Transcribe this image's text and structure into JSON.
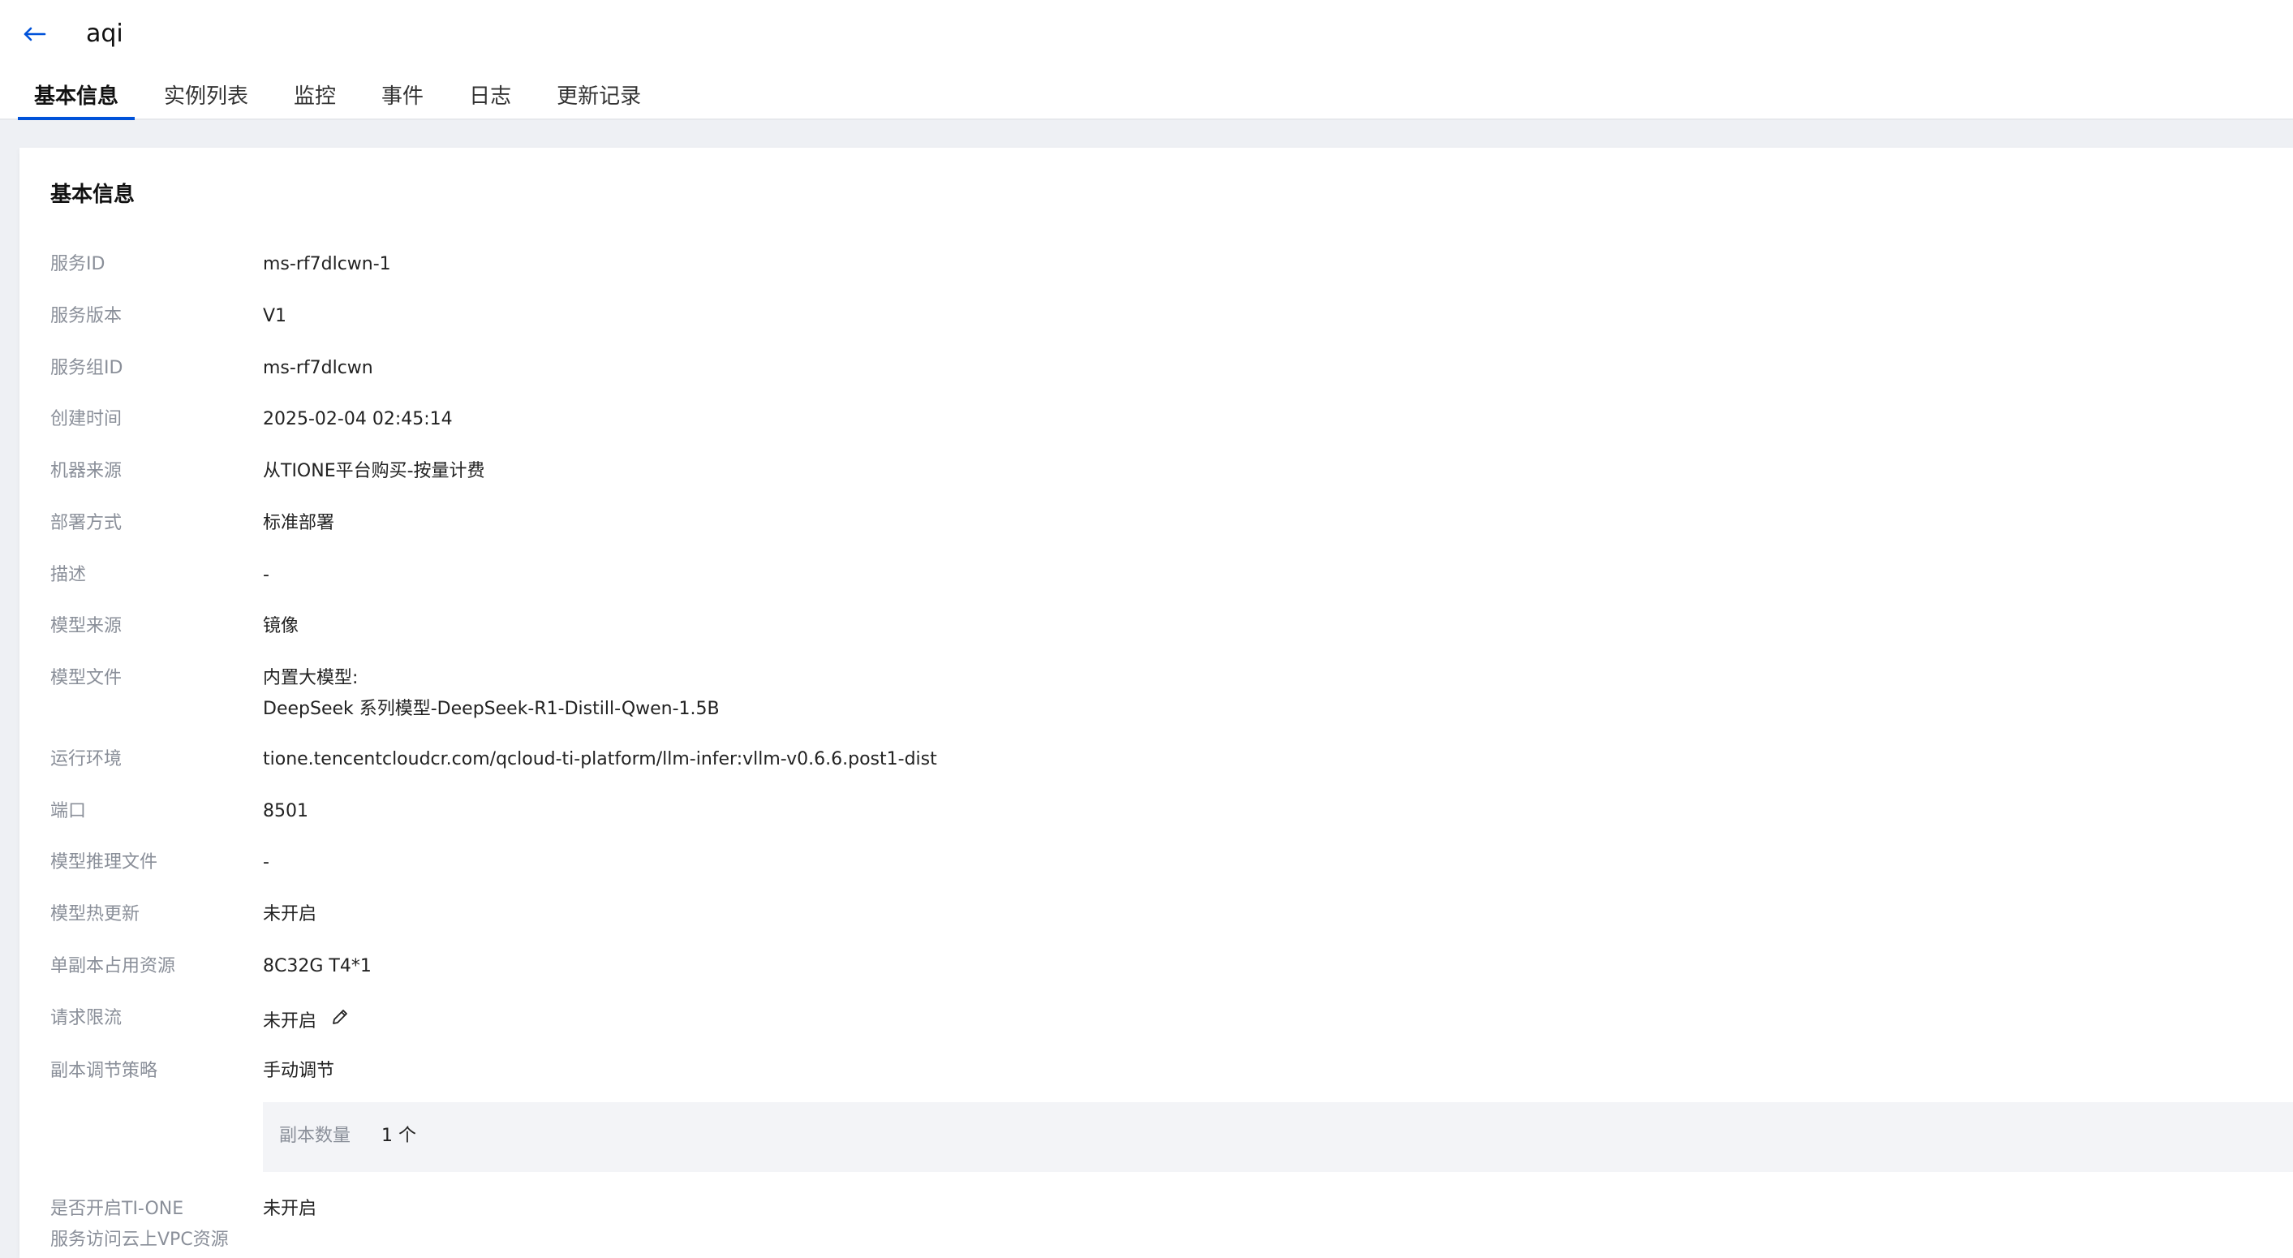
{
  "header": {
    "title": "aqi",
    "tabs": [
      {
        "label": "基本信息",
        "active": true
      },
      {
        "label": "实例列表",
        "active": false
      },
      {
        "label": "监控",
        "active": false
      },
      {
        "label": "事件",
        "active": false
      },
      {
        "label": "日志",
        "active": false
      },
      {
        "label": "更新记录",
        "active": false
      }
    ]
  },
  "basic_info": {
    "title": "基本信息",
    "rows": [
      {
        "label": "服务ID",
        "value": "ms-rf7dlcwn-1"
      },
      {
        "label": "服务版本",
        "value": "V1"
      },
      {
        "label": "服务组ID",
        "value": "ms-rf7dlcwn"
      },
      {
        "label": "创建时间",
        "value": "2025-02-04 02:45:14"
      },
      {
        "label": "机器来源",
        "value": "从TIONE平台购买-按量计费"
      },
      {
        "label": "部署方式",
        "value": "标准部署"
      },
      {
        "label": "描述",
        "value": "-"
      },
      {
        "label": "模型来源",
        "value": "镜像"
      },
      {
        "label": "模型文件",
        "value": "内置大模型:",
        "value2": "DeepSeek 系列模型-DeepSeek-R1-Distill-Qwen-1.5B"
      },
      {
        "label": "运行环境",
        "value": "tione.tencentcloudcr.com/qcloud-ti-platform/llm-infer:vllm-v0.6.6.post1-dist"
      },
      {
        "label": "端口",
        "value": "8501"
      },
      {
        "label": "模型推理文件",
        "value": "-"
      },
      {
        "label": "模型热更新",
        "value": "未开启"
      },
      {
        "label": "单副本占用资源",
        "value": "8C32G T4*1"
      },
      {
        "label": "请求限流",
        "value": "未开启"
      },
      {
        "label": "副本调节策略",
        "value": "手动调节"
      },
      {
        "label": "是否开启TI-ONE",
        "label2": "服务访问云上VPC资源",
        "value": "未开启"
      }
    ],
    "replica": {
      "label": "副本数量",
      "value": "1 个"
    }
  },
  "colors": {
    "accent": "#0052d9",
    "label": "#8a8f99",
    "page_bg": "#eef0f4"
  },
  "icons": {
    "back": "arrow-left-icon",
    "edit": "pencil-icon"
  }
}
